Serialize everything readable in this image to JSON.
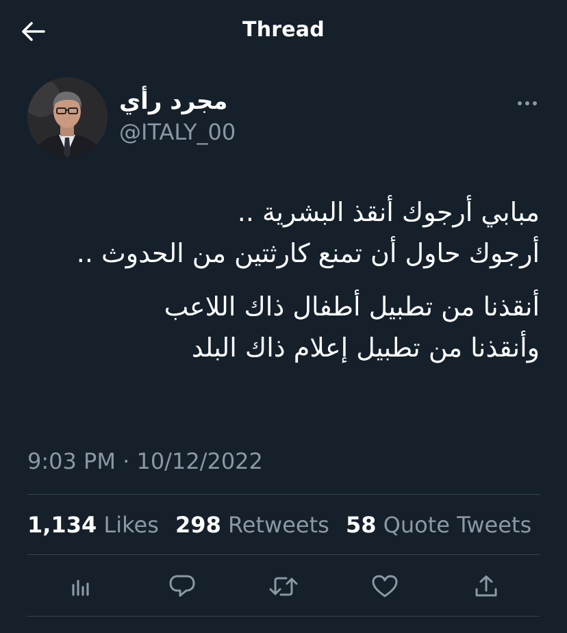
{
  "header": {
    "title": "Thread",
    "back_icon": "arrow-left-icon"
  },
  "author": {
    "display_name": "مجرد رأي",
    "handle": "@ITALY_00"
  },
  "tweet": {
    "paragraph1_line1": "مبابي أرجوك أنقذ البشرية ..",
    "paragraph1_line2": "أرجوك حاول أن تمنع كارثتين من الحدوث ..",
    "paragraph2_line1": "أنقذنا من تطبيل أطفال ذاك اللاعب",
    "paragraph2_line2": "وأنقذنا من تطبيل إعلام ذاك البلد"
  },
  "meta": {
    "timestamp": "9:03 PM · 10/12/2022"
  },
  "stats": {
    "likes_count": "1,134",
    "likes_label": "Likes",
    "retweets_count": "298",
    "retweets_label": "Retweets",
    "quotes_count": "58",
    "quotes_label": "Quote Tweets"
  },
  "actions": [
    "analytics-icon",
    "reply-icon",
    "retweet-icon",
    "like-icon",
    "share-icon"
  ],
  "colors": {
    "background": "#15202b",
    "text": "#ffffff",
    "secondary": "#8b98a5",
    "divider": "#38444d"
  }
}
